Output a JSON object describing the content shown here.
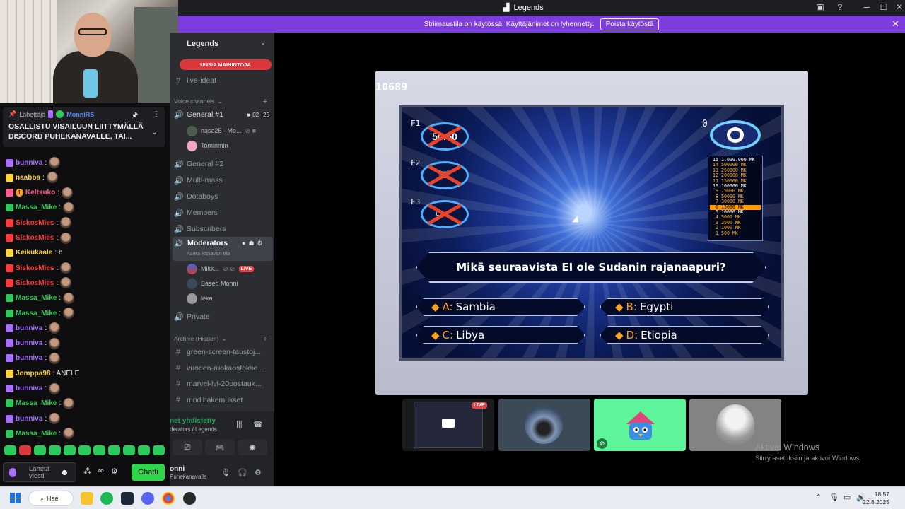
{
  "titlebar": {
    "title": "Legends",
    "help_icon": "?",
    "min": "─",
    "max": "☐",
    "close": "✕"
  },
  "banner": {
    "text": "Striimaustila on käytössä. Käyttäjänimet on lyhennetty.",
    "button": "Poista käytöstä"
  },
  "pinned": {
    "label": "Lähettäjä",
    "user": "MonniRS",
    "message": "OSALLISTU VISAILUUN LIITTYMÄLLÄ DISCORD PUHEKANAVALLE, TAI..."
  },
  "chat_messages": [
    {
      "user": "bunniva",
      "color": "#a970ff",
      "text": ":",
      "emote": true
    },
    {
      "user": "naabba",
      "color": "#ffd43b",
      "text": ":",
      "emote": true
    },
    {
      "user": "Keltsuko",
      "color": "#ff5f8f",
      "text": ":",
      "emote": true,
      "badge_text": "1"
    },
    {
      "user": "Massa_Mike",
      "color": "#2ec95b",
      "text": ":",
      "emote": true
    },
    {
      "user": "SiskosMies",
      "color": "#ff3b3b",
      "text": ":",
      "emote": true
    },
    {
      "user": "SiskosMies",
      "color": "#ff3b3b",
      "text": ":",
      "emote": true
    },
    {
      "user": "Keikukaale",
      "color": "#ffd43b",
      "text": ": b",
      "emote": false
    },
    {
      "user": "SiskosMies",
      "color": "#ff3b3b",
      "text": ":",
      "emote": true
    },
    {
      "user": "SiskosMies",
      "color": "#ff3b3b",
      "text": ":",
      "emote": true
    },
    {
      "user": "Massa_Mike",
      "color": "#2ec95b",
      "text": ":",
      "emote": true
    },
    {
      "user": "Massa_Mike",
      "color": "#2ec95b",
      "text": ":",
      "emote": true
    },
    {
      "user": "bunniva",
      "color": "#a970ff",
      "text": ":",
      "emote": true
    },
    {
      "user": "bunniva",
      "color": "#a970ff",
      "text": ":",
      "emote": true
    },
    {
      "user": "bunniva",
      "color": "#a970ff",
      "text": ":",
      "emote": true
    },
    {
      "user": "Jomppa98",
      "color": "#ffd43b",
      "text": ": ANELE",
      "emote": false
    },
    {
      "user": "bunniva",
      "color": "#a970ff",
      "text": ":",
      "emote": true
    },
    {
      "user": "Massa_Mike",
      "color": "#2ec95b",
      "text": ":",
      "emote": true
    },
    {
      "user": "bunniva",
      "color": "#a970ff",
      "text": ":",
      "emote": true
    },
    {
      "user": "Massa_Mike",
      "color": "#2ec95b",
      "text": ":",
      "emote": true
    }
  ],
  "chat_input": {
    "placeholder": "Lähetä viesti",
    "send": "Chatti",
    "points": "∞"
  },
  "server": {
    "name": "Legends",
    "mentions": "UUSIA MAININTOJA"
  },
  "channels": {
    "live_ideat": "live-ideat",
    "voice_category": "Voice channels",
    "general1": "General #1",
    "general1_count_a": "02",
    "general1_count_b": "25",
    "user_nasa": "nasa25 - Mo...",
    "user_tominmin": "Tominmin",
    "general2": "General #2",
    "multimass": "Multi-mass",
    "dotaboys": "Dotaboys",
    "members": "Members",
    "subscribers": "Subscribers",
    "moderators": "Moderators",
    "moderators_sub": "Aseta kanavan tila",
    "user_mikk": "Mikk...",
    "live": "LIVE",
    "user_based": "Based Monni",
    "user_leka": "leka",
    "private": "Private",
    "archive_category": "Archive (Hidden)",
    "arch1": "green-screen-taustoj...",
    "arch2": "vuoden-ruokaostokse...",
    "arch3": "marvel-lvl-20postauk...",
    "arch4": "modihakemukset"
  },
  "voice_status": {
    "connected": "net yhdistetty",
    "channel": "derators / Legends"
  },
  "user": {
    "name": "onni",
    "status": "Puhekanavalla"
  },
  "game": {
    "counter": "10689",
    "lifelines": [
      "F1",
      "F2",
      "F3"
    ],
    "fifty_label": "50:50",
    "score": "0",
    "ladder": [
      {
        "n": "15",
        "v": "1.000.000 MK",
        "milestone": true
      },
      {
        "n": "14",
        "v": "500000 MK"
      },
      {
        "n": "13",
        "v": "250000 MK"
      },
      {
        "n": "12",
        "v": "200000 MK"
      },
      {
        "n": "11",
        "v": "150000 MK"
      },
      {
        "n": "10",
        "v": "100000 MK",
        "milestone": true
      },
      {
        "n": "9",
        "v": "75000 MK"
      },
      {
        "n": "8",
        "v": "50000 MK"
      },
      {
        "n": "7",
        "v": "30000 MK"
      },
      {
        "n": "6",
        "v": "15000 MK",
        "current": true
      },
      {
        "n": "5",
        "v": "10000 MK",
        "milestone": true
      },
      {
        "n": "4",
        "v": "5000 MK"
      },
      {
        "n": "3",
        "v": "2500 MK"
      },
      {
        "n": "2",
        "v": "1000 MK"
      },
      {
        "n": "1",
        "v": "500 MK"
      }
    ],
    "question": "Mikä seuraavista EI ole Sudanin rajanaapuri?",
    "answers": [
      {
        "key": "A:",
        "text": "Sambia"
      },
      {
        "key": "B:",
        "text": "Egypti"
      },
      {
        "key": "C:",
        "text": "Libya"
      },
      {
        "key": "D:",
        "text": "Etiopia"
      }
    ]
  },
  "tiles": {
    "live": "LIVE"
  },
  "windows_activate": {
    "title": "Aktivoi Windows",
    "sub": "Siirry asetuksiin ja aktivoi Windows."
  },
  "taskbar": {
    "search": "Hae",
    "time": "18.57",
    "date": "22.8.2025"
  }
}
